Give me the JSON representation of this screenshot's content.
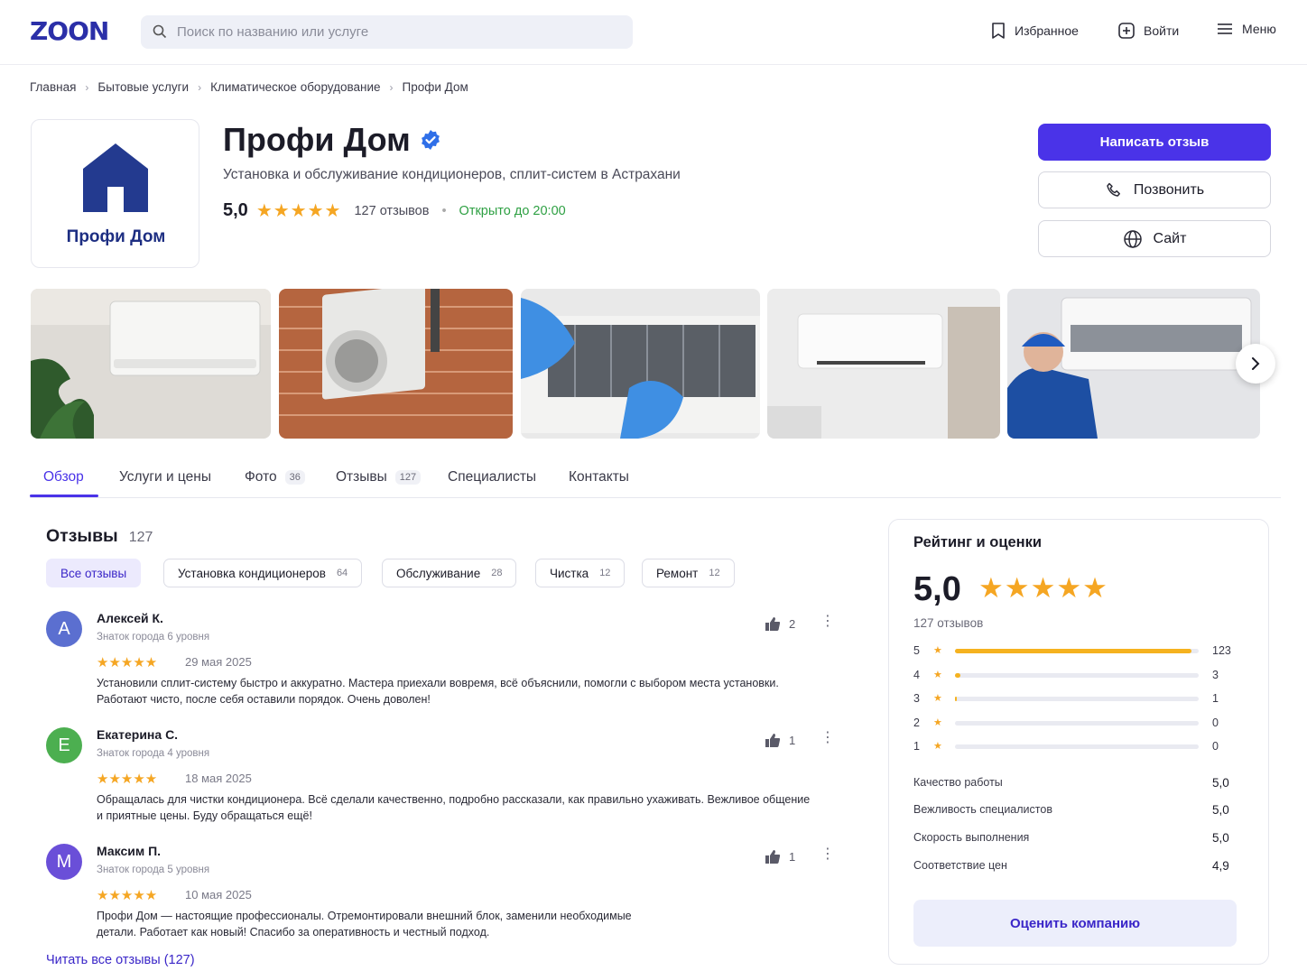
{
  "header": {
    "logo": "ZOON",
    "search_placeholder": "Поиск по названию или услуге",
    "favorites": "Избранное",
    "login": "Войти",
    "menu": "Меню"
  },
  "breadcrumbs": [
    "Главная",
    "Бытовые услуги",
    "Климатическое оборудование",
    "Профи Дом"
  ],
  "company": {
    "logo_text": "Профи Дом",
    "name": "Профи Дом",
    "description": "Установка и обслуживание кондиционеров, сплит-систем в Астрахани",
    "rating": "5,0",
    "stars": "★★★★★",
    "reviews_count": "127 отзывов",
    "open_status": "Открыто до 20:00"
  },
  "actions": {
    "write_review": "Написать отзыв",
    "call": "Позвонить",
    "site": "Сайт"
  },
  "gallery": {
    "photos": [
      "ac-indoor-unit-with-plant",
      "ac-outdoor-unit-brick-wall",
      "ac-filter-cleaning-gloves",
      "ac-unit-white-wall",
      "technician-servicing-ac"
    ]
  },
  "tabs": [
    {
      "label": "Обзор",
      "badge": ""
    },
    {
      "label": "Услуги и цены",
      "badge": ""
    },
    {
      "label": "Фото",
      "badge": "36"
    },
    {
      "label": "Отзывы",
      "badge": "127"
    },
    {
      "label": "Специалисты",
      "badge": ""
    },
    {
      "label": "Контакты",
      "badge": ""
    }
  ],
  "reviews": {
    "title": "Отзывы",
    "count": "127",
    "filters": [
      {
        "label": "Все отзывы",
        "count": ""
      },
      {
        "label": "Установка кондиционеров",
        "count": "64"
      },
      {
        "label": "Обслуживание",
        "count": "28"
      },
      {
        "label": "Чистка",
        "count": "12"
      },
      {
        "label": "Ремонт",
        "count": "12"
      }
    ],
    "items": [
      {
        "initial": "A",
        "name": "Алексей К.",
        "level": "Знаток города 6 уровня",
        "stars": "★★★★★",
        "date": "29 мая 2025",
        "likes": "2",
        "text": "Установили сплит-систему быстро и аккуратно. Мастера приехали вовремя, всё объяснили, помогли с выбором места установки. Работают чисто, после себя оставили порядок. Очень доволен!",
        "color": "#5b6fd0"
      },
      {
        "initial": "E",
        "name": "Екатерина С.",
        "level": "Знаток города 4 уровня",
        "stars": "★★★★★",
        "date": "18 мая 2025",
        "likes": "1",
        "text": "Обращалась для чистки кондиционера. Всё сделали качественно, подробно рассказали, как правильно ухаживать. Вежливое общение и приятные цены. Буду обращаться ещё!",
        "color": "#4caf50"
      },
      {
        "initial": "M",
        "name": "Максим П.",
        "level": "Знаток города 5 уровня",
        "stars": "★★★★★",
        "date": "10 мая 2025",
        "likes": "1",
        "text": "Профи Дом — настоящие профессионалы. Отремонтировали внешний блок, заменили необходимые детали.  Работает как новый! Спасибо за оперативность и честный подход.",
        "color": "#6a4fd8"
      }
    ],
    "read_all": "Читать все отзывы (127)"
  },
  "rating_panel": {
    "title": "Рейтинг и оценки",
    "value": "5,0",
    "stars": "★★★★★",
    "count": "127 отзывов",
    "distribution": [
      {
        "level": "5",
        "count": "123",
        "fraction": 0.969
      },
      {
        "level": "4",
        "count": "3",
        "fraction": 0.024
      },
      {
        "level": "3",
        "count": "1",
        "fraction": 0.008
      },
      {
        "level": "2",
        "count": "0",
        "fraction": 0
      },
      {
        "level": "1",
        "count": "0",
        "fraction": 0
      }
    ],
    "criteria": [
      {
        "label": "Качество работы",
        "value": "5,0"
      },
      {
        "label": "Вежливость специалистов",
        "value": "5,0"
      },
      {
        "label": "Скорость выполнения",
        "value": "5,0"
      },
      {
        "label": "Соответствие цен",
        "value": "4,9"
      }
    ],
    "rate_button": "Оценить компанию"
  },
  "colors": {
    "accent": "#4a33e8",
    "star": "#f5a623",
    "open": "#2ea043",
    "brand_dark": "#1d2e82"
  }
}
